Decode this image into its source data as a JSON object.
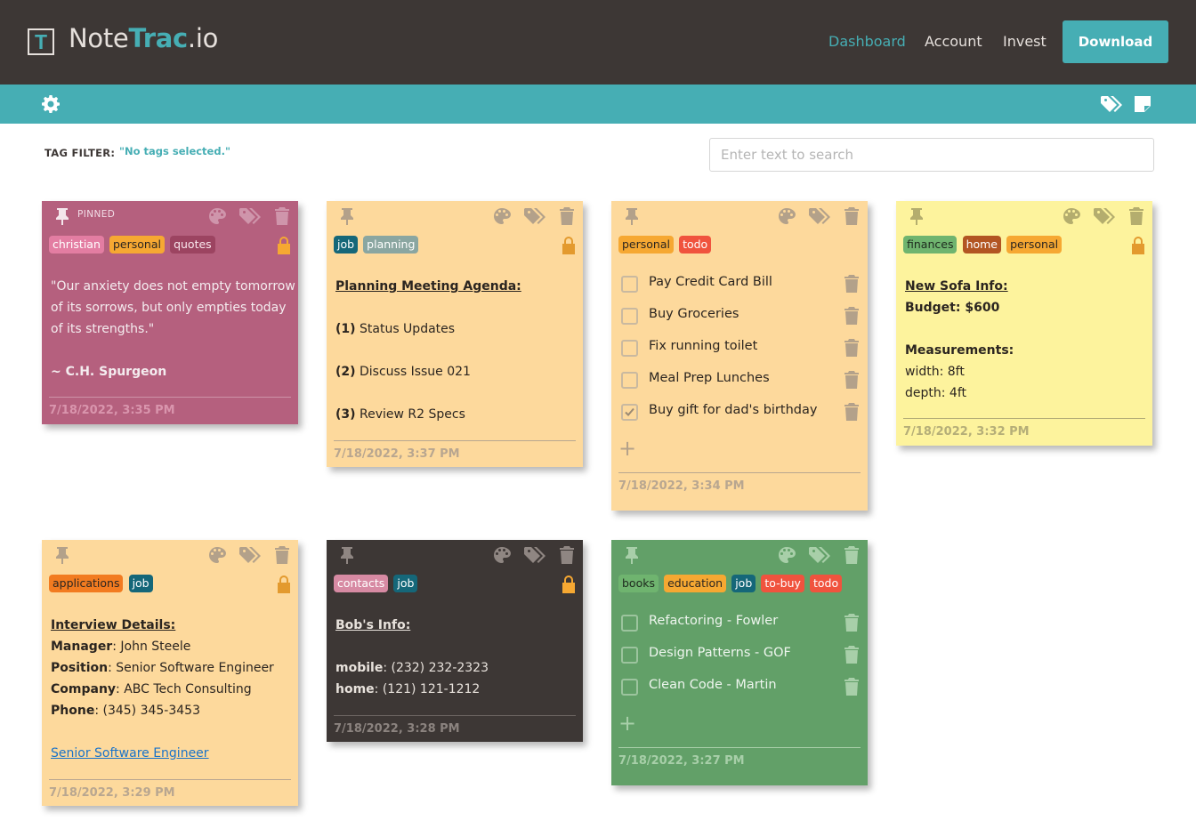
{
  "header": {
    "logo_letter": "T",
    "logo_prefix": "Note",
    "logo_accent": "Trac",
    "logo_suffix": ".io",
    "nav": [
      "Dashboard",
      "Account",
      "Invest"
    ],
    "download_label": "Download"
  },
  "filter": {
    "label": "TAG FILTER:",
    "value": "\"No tags selected.\"",
    "search_placeholder": "Enter text to search"
  },
  "notes": [
    {
      "pinned_label": "PINNED",
      "tags": [
        "christian",
        "personal",
        "quotes"
      ],
      "lines": [
        "\"Our anxiety does not empty tomorrow",
        "of its sorrows, but only empties today",
        "of its strengths.\"",
        "",
        "~ C.H. Spurgeon"
      ],
      "timestamp": "7/18/2022, 3:35 PM"
    },
    {
      "tags": [
        "job",
        "planning"
      ],
      "title": "Planning Meeting Agenda:",
      "items": [
        {
          "num": "(1)",
          "text": " Status Updates"
        },
        {
          "num": "(2)",
          "text": " Discuss Issue 021"
        },
        {
          "num": "(3)",
          "text": " Review R2 Specs"
        }
      ],
      "timestamp": "7/18/2022, 3:37 PM"
    },
    {
      "tags": [
        "personal",
        "todo"
      ],
      "todos": [
        {
          "text": "Pay Credit Card Bill",
          "checked": false
        },
        {
          "text": "Buy Groceries",
          "checked": false
        },
        {
          "text": "Fix running toilet",
          "checked": false
        },
        {
          "text": "Meal Prep Lunches",
          "checked": false
        },
        {
          "text": "Buy gift for dad's birthday",
          "checked": true
        }
      ],
      "add_label": "+",
      "timestamp": "7/18/2022, 3:34 PM"
    },
    {
      "tags": [
        "finances",
        "home",
        "personal"
      ],
      "title": "New Sofa Info:",
      "budget_label": "Budget:",
      "budget_value": " $600",
      "measure_label": "Measurements:",
      "width": "width: 8ft",
      "depth": "depth: 4ft",
      "timestamp": "7/18/2022, 3:32 PM"
    },
    {
      "tags": [
        "applications",
        "job"
      ],
      "title": "Interview Details:",
      "fields": [
        {
          "label": "Manager",
          "value": ": John Steele"
        },
        {
          "label": "Position",
          "value": ": Senior Software Engineer"
        },
        {
          "label": "Company",
          "value": ": ABC Tech Consulting"
        },
        {
          "label": "Phone",
          "value": ": (345) 345-3453"
        }
      ],
      "link": "Senior Software Engineer",
      "timestamp": "7/18/2022, 3:29 PM"
    },
    {
      "tags": [
        "contacts",
        "job"
      ],
      "title": "Bob's Info:",
      "fields": [
        {
          "label": "mobile",
          "value": ": (232) 232-2323"
        },
        {
          "label": "home",
          "value": ": (121) 121-1212"
        }
      ],
      "timestamp": "7/18/2022, 3:28 PM"
    },
    {
      "tags": [
        "books",
        "education",
        "job",
        "to-buy",
        "todo"
      ],
      "todos": [
        {
          "text": "Refactoring - Fowler",
          "checked": false
        },
        {
          "text": "Design Patterns - GOF",
          "checked": false
        },
        {
          "text": "Clean Code - Martin",
          "checked": false
        }
      ],
      "add_label": "+",
      "timestamp": "7/18/2022, 3:27 PM"
    }
  ],
  "colors": {
    "header_bg": "#3d3735",
    "accent": "#46aeb4",
    "note_pink": "#b5607e",
    "note_orange": "#fdd99c",
    "note_yellow": "#fdf39d",
    "note_dark": "#3d3735",
    "note_green": "#62a068"
  }
}
